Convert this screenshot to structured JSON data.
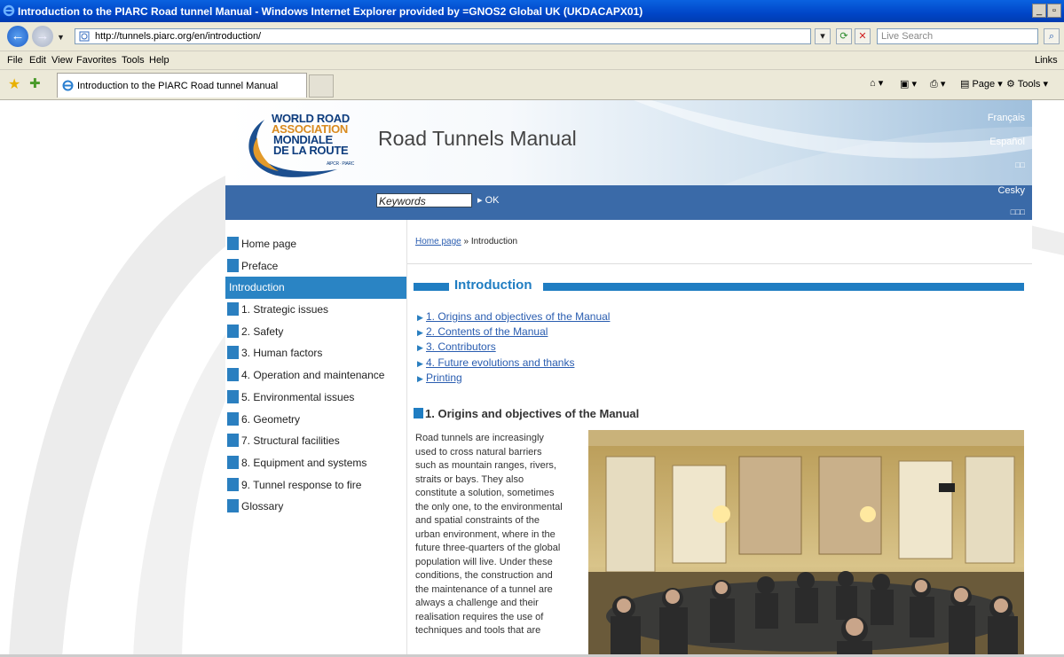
{
  "browser": {
    "window_title": "Introduction to the PIARC Road tunnel Manual - Windows Internet Explorer provided by =GNOS2 Global UK (UKDACAPX01)",
    "address": "http://tunnels.piarc.org/en/introduction/",
    "search_placeholder": "Live Search",
    "menu": [
      "File",
      "Edit",
      "View",
      "Favorites",
      "Tools",
      "Help"
    ],
    "links_label": "Links",
    "tab_title": "Introduction to the PIARC Road tunnel Manual",
    "commands": {
      "page": "Page",
      "tools": "Tools"
    },
    "window_buttons": {
      "minimize": "_",
      "restore": "̷"
    }
  },
  "site": {
    "logo": {
      "line1": "WORLD ROAD",
      "line2": "ASSOCIATION",
      "line3": "MONDIALE",
      "line4": "DE LA ROUTE",
      "line5": "AIPCR · PIARC"
    },
    "title": "Road Tunnels Manual",
    "languages": [
      "Français",
      "Español",
      "□□",
      "Cesky",
      "□□□"
    ],
    "search": {
      "placeholder": "Keywords",
      "ok": "OK"
    }
  },
  "sidebar": {
    "items": [
      {
        "label": "Home page"
      },
      {
        "label": "Preface"
      },
      {
        "label": "Introduction",
        "active": true
      },
      {
        "label": "1. Strategic issues"
      },
      {
        "label": "2. Safety"
      },
      {
        "label": "3. Human factors"
      },
      {
        "label": "4. Operation and maintenance"
      },
      {
        "label": "5. Environmental issues"
      },
      {
        "label": "6. Geometry"
      },
      {
        "label": "7. Structural facilities"
      },
      {
        "label": "8. Equipment and systems"
      },
      {
        "label": "9. Tunnel response to fire"
      },
      {
        "label": "Glossary"
      }
    ]
  },
  "main": {
    "breadcrumb": {
      "home": "Home page",
      "separator": " » ",
      "current": "Introduction"
    },
    "section_title": "Introduction",
    "toc": [
      "1. Origins and objectives of the Manual",
      "2. Contents of the Manual",
      "3. Contributors",
      "4. Future evolutions and thanks",
      "Printing"
    ],
    "heading": "1. Origins and objectives of the Manual",
    "body_lines": [
      "Road tunnels are increasingly",
      "used to cross natural barriers",
      "such as mountain ranges, rivers,",
      "straits or bays. They also",
      "constitute a solution, sometimes",
      "the only one, to the environmental",
      "and spatial constraints of the",
      "urban environment, where in the",
      "future three-quarters of the global",
      "population will live. Under these",
      "conditions, the construction and",
      "the maintenance of a tunnel are",
      "always a challenge and their",
      "realisation requires the use of",
      "techniques and tools that are"
    ]
  },
  "colors": {
    "accent": "#1f7dc2",
    "header_bar": "#3a6aa8",
    "ie_titlebar": "#0054e3"
  }
}
